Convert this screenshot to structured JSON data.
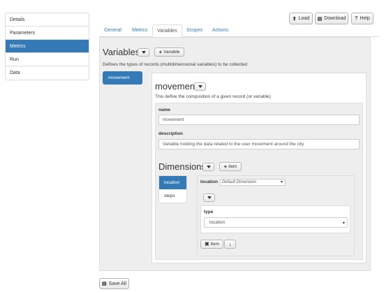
{
  "nav": {
    "items": [
      {
        "label": "Details"
      },
      {
        "label": "Parameters"
      },
      {
        "label": "Metrics"
      },
      {
        "label": "Run"
      },
      {
        "label": "Data"
      }
    ]
  },
  "toolbar": {
    "load_label": "Load",
    "download_label": "Download",
    "help_label": "Help"
  },
  "tabs": [
    {
      "label": "General"
    },
    {
      "label": "Metrics"
    },
    {
      "label": "Variables"
    },
    {
      "label": "Scopes"
    },
    {
      "label": "Actions"
    }
  ],
  "variables": {
    "title": "Variables",
    "add_label": "Variable",
    "description": "Defines the types of records (multidimensional variables) to be collected",
    "items": [
      {
        "label": "movement"
      }
    ]
  },
  "movement": {
    "title": "movement",
    "description": "This define the composition of a given record (or variable)",
    "name_label": "name",
    "name_value": "movement",
    "description_label": "description",
    "description_value": "Variable holding the data related to the user movement around the city"
  },
  "dimensions": {
    "title": "Dimensions",
    "add_label": "item",
    "items": [
      {
        "label": "location"
      },
      {
        "label": "steps"
      }
    ],
    "location_label": "location",
    "location_select": "Default Dimension",
    "type_label": "type",
    "type_select": "location",
    "remove_label": "item"
  },
  "footer": {
    "save_label": "Save All"
  },
  "colors": {
    "accent": "#337ab7",
    "panel": "#eeeeee",
    "border": "#dddddd"
  }
}
